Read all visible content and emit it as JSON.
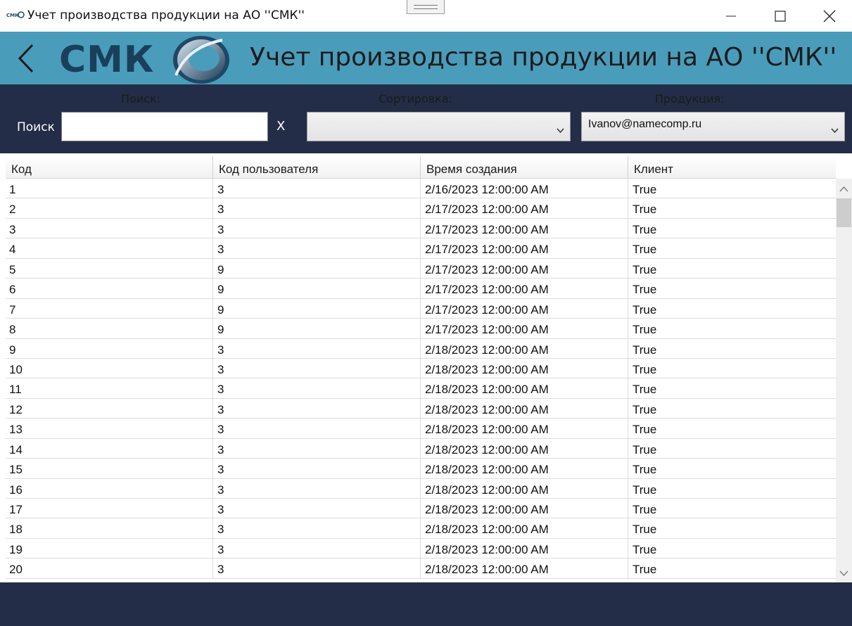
{
  "window": {
    "title": "Учет производства продукции на АО ''СМК''",
    "icon_name": "app-logo-icon",
    "controls": [
      "minimize-icon",
      "maximize-icon",
      "close-icon"
    ]
  },
  "header": {
    "logo_text": "СМК",
    "title": "Учет производства продукции на АО ''СМК''",
    "back_icon": "chevron-left-icon",
    "background": "#4a9cbb"
  },
  "toolbar": {
    "background": "#232d47",
    "search_group_label": "Поиск:",
    "search_caption": "Поиск",
    "search_value": "",
    "clear_label": "X",
    "sort_label": "Сортировка:",
    "sort_value": "",
    "product_label": "Продукция:",
    "product_value": "Ivanov@namecomp.ru"
  },
  "table": {
    "columns": [
      "Код",
      "Код пользователя",
      "Время создания",
      "Клиент"
    ],
    "rows": [
      [
        "1",
        "3",
        "2/16/2023 12:00:00 AM",
        "True"
      ],
      [
        "2",
        "3",
        "2/17/2023 12:00:00 AM",
        "True"
      ],
      [
        "3",
        "3",
        "2/17/2023 12:00:00 AM",
        "True"
      ],
      [
        "4",
        "3",
        "2/17/2023 12:00:00 AM",
        "True"
      ],
      [
        "5",
        "9",
        "2/17/2023 12:00:00 AM",
        "True"
      ],
      [
        "6",
        "9",
        "2/17/2023 12:00:00 AM",
        "True"
      ],
      [
        "7",
        "9",
        "2/17/2023 12:00:00 AM",
        "True"
      ],
      [
        "8",
        "9",
        "2/17/2023 12:00:00 AM",
        "True"
      ],
      [
        "9",
        "3",
        "2/18/2023 12:00:00 AM",
        "True"
      ],
      [
        "10",
        "3",
        "2/18/2023 12:00:00 AM",
        "True"
      ],
      [
        "11",
        "3",
        "2/18/2023 12:00:00 AM",
        "True"
      ],
      [
        "12",
        "3",
        "2/18/2023 12:00:00 AM",
        "True"
      ],
      [
        "13",
        "3",
        "2/18/2023 12:00:00 AM",
        "True"
      ],
      [
        "14",
        "3",
        "2/18/2023 12:00:00 AM",
        "True"
      ],
      [
        "15",
        "3",
        "2/18/2023 12:00:00 AM",
        "True"
      ],
      [
        "16",
        "3",
        "2/18/2023 12:00:00 AM",
        "True"
      ],
      [
        "17",
        "3",
        "2/18/2023 12:00:00 AM",
        "True"
      ],
      [
        "18",
        "3",
        "2/18/2023 12:00:00 AM",
        "True"
      ],
      [
        "19",
        "3",
        "2/18/2023 12:00:00 AM",
        "True"
      ],
      [
        "20",
        "3",
        "2/18/2023 12:00:00 AM",
        "True"
      ]
    ]
  }
}
